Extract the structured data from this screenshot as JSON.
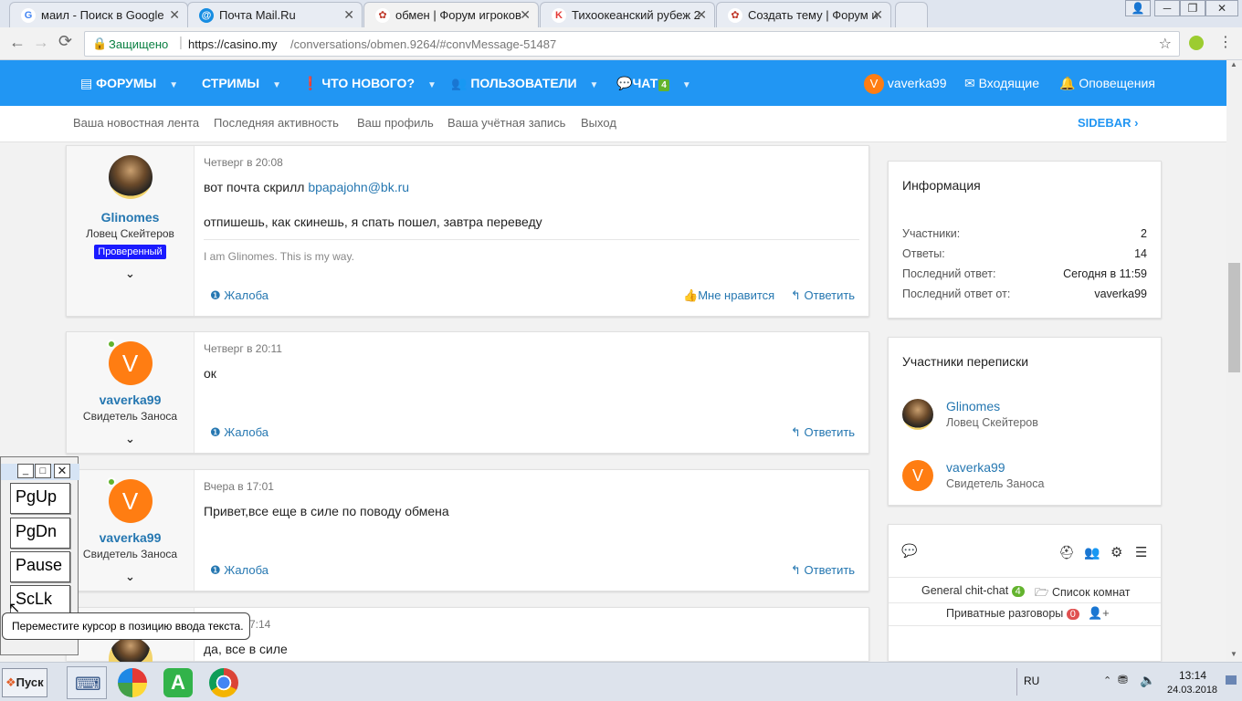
{
  "browser": {
    "tabs": [
      {
        "title": "маил - Поиск в Google",
        "icon": "google-icon",
        "color": "#4285f4",
        "glyph": "G"
      },
      {
        "title": "Почта Mail.Ru",
        "icon": "mailru-icon",
        "color": "#168de2",
        "glyph": "@"
      },
      {
        "title": "обмен | Форум игроков",
        "icon": "casino-icon",
        "color": "#c0392b",
        "glyph": "✿"
      },
      {
        "title": "Тихоокеанский рубеж 2",
        "icon": "kinopoisk-icon",
        "color": "#e53935",
        "glyph": "K"
      },
      {
        "title": "Создать тему | Форум и",
        "icon": "casino-icon",
        "color": "#c0392b",
        "glyph": "✿"
      }
    ],
    "secure_label": "Защищено",
    "url_host": "https://casino.my",
    "url_path": "/conversations/obmen.9264/#convMessage-51487"
  },
  "forum_nav": {
    "items": [
      "ФОРУМЫ",
      "СТРИМЫ",
      "ЧТО НОВОГО?",
      "ПОЛЬЗОВАТЕЛИ",
      "ЧАТ"
    ],
    "chat_count": "4",
    "user": "vaverka99",
    "user_initial": "V",
    "inbox": "Входящие",
    "alerts": "Оповещения"
  },
  "sub_nav": {
    "items": [
      "Ваша новостная лента",
      "Последняя активность",
      "Ваш профиль",
      "Ваша учётная запись",
      "Выход"
    ],
    "sidebar_label": "SIDEBAR"
  },
  "messages": [
    {
      "user": "Glinomes",
      "user_title": "Ловец Скейтеров",
      "badge": "Проверенный",
      "date": "Четверг в 20:08",
      "line1_prefix": "вот почта скрилл ",
      "line1_link": "bpapajohn@bk.ru",
      "line2": "отпишешь, как скинешь, я спать пошел, завтра переведу",
      "signature": "I am Glinomes. This is my way.",
      "report": "Жалоба",
      "like": "Мне нравится",
      "reply": "Ответить"
    },
    {
      "user": "vaverka99",
      "user_title": "Свидетель Заноса",
      "initial": "V",
      "date": "Четверг в 20:11",
      "text": "ок",
      "report": "Жалоба",
      "reply": "Ответить"
    },
    {
      "user": "vaverka99",
      "user_title": "Свидетель Заноса",
      "initial": "V",
      "date": "Вчера в 17:01",
      "text": "Привет,все еще в силе по поводу обмена",
      "report": "Жалоба",
      "reply": "Ответить"
    },
    {
      "date_partial": "7:14",
      "text": "да, все в силе"
    }
  ],
  "info_panel": {
    "title": "Информация",
    "rows": [
      {
        "label": "Участники:",
        "value": "2"
      },
      {
        "label": "Ответы:",
        "value": "14"
      },
      {
        "label": "Последний ответ:",
        "value": "Сегодня в 11:59"
      },
      {
        "label": "Последний ответ от:",
        "value": "vaverka99"
      }
    ]
  },
  "participants_panel": {
    "title": "Участники переписки",
    "people": [
      {
        "name": "Glinomes",
        "title": "Ловец Скейтеров"
      },
      {
        "name": "vaverka99",
        "title": "Свидетель Заноса",
        "initial": "V"
      }
    ]
  },
  "chat_panel": {
    "general": "General chit-chat",
    "general_count": "4",
    "rooms": "Список комнат",
    "private": "Приватные разговоры",
    "private_count": "0"
  },
  "osk": {
    "keys": [
      "PgUp",
      "PgDn",
      "Pause",
      "ScLk"
    ],
    "tooltip": "Переместите курсор в позицию ввода текста."
  },
  "taskbar": {
    "start": "Пуск",
    "lang": "RU",
    "time": "13:14",
    "date": "24.03.2018"
  },
  "colors": {
    "brand": "#2196f3",
    "link": "#2577b1",
    "avatar": "#ff7d12",
    "badge": "#1a1aff"
  }
}
